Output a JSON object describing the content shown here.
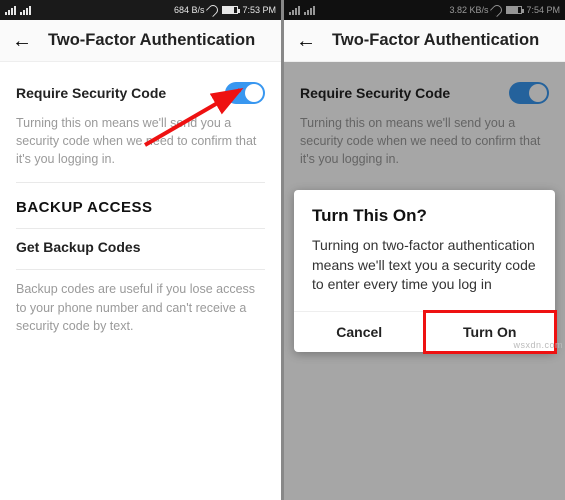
{
  "left": {
    "status": {
      "net": "684 B/s",
      "time": "7:53 PM",
      "batt": "73"
    },
    "title": "Two-Factor Authentication",
    "require_label": "Require Security Code",
    "desc1": "Turning this on means we'll send you a security code when we need to confirm that it's you logging in.",
    "section_backup": "BACKUP ACCESS",
    "get_backup": "Get Backup Codes",
    "desc2": "Backup codes are useful if you lose access to your phone number and can't receive a security code by text."
  },
  "right": {
    "status": {
      "net": "3.82 KB/s",
      "time": "7:54 PM",
      "batt": "73"
    },
    "title": "Two-Factor Authentication",
    "require_label": "Require Security Code",
    "desc1": "Turning this on means we'll send you a security code when we need to confirm that it's you logging in."
  },
  "dialog": {
    "title": "Turn This On?",
    "body": "Turning on two-factor authentication means we'll text you a security code to enter every time you log in",
    "cancel": "Cancel",
    "turn_on": "Turn On"
  },
  "watermark": "wsxdn.com",
  "colors": {
    "accent": "#3897f0",
    "highlight": "#e11"
  }
}
